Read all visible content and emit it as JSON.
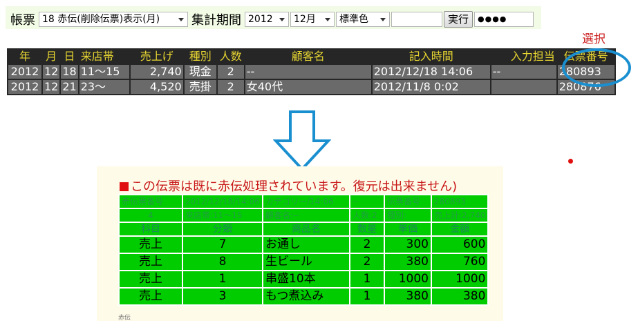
{
  "toolbar": {
    "slip_label": "帳票",
    "slip_select": "18 赤伝(削除伝票)表示(月)",
    "period_label": "集計期間",
    "year_select": "2012",
    "month_select": "12月",
    "color_select": "標準色",
    "text_value": "",
    "run_button": "実行",
    "password_mask": "●●●●"
  },
  "annotation": {
    "select_label": "選択",
    "circle_color": "#1a8fd0",
    "arrow_color": "#1a8fd0"
  },
  "top_table": {
    "headers": [
      "年",
      "月",
      "日",
      "来店帯",
      "売上げ",
      "種別",
      "人数",
      "顧客名",
      "記入時間",
      "入力担当",
      "伝票番号"
    ],
    "rows": [
      [
        "2012",
        "12",
        "18",
        "11～15",
        "2,740",
        "現金",
        "2",
        "--",
        "2012/12/18 14:06",
        "--",
        "280893"
      ],
      [
        "2012",
        "12",
        "21",
        "23～",
        "4,520",
        "売掛",
        "2",
        "女40代",
        "2012/11/8 0:02",
        "",
        "280876"
      ]
    ],
    "header_color": "#e6d531"
  },
  "detail": {
    "message": "この伝票は既に赤伝処理されています。復元は出来ません)",
    "info_row1": [
      "赤伝票番号",
      "2012/12/18/14:06",
      "カテゴリー/14:06",
      "--",
      "伝票番号",
      "280893"
    ],
    "info_row2": [
      "4",
      "来店帯:11～15",
      "顧客名:--",
      "人数:2",
      "種別:",
      "売上計:2,740"
    ],
    "headers": [
      "科目",
      "分類",
      "商品名",
      "数量",
      "単価",
      "金額"
    ],
    "items": [
      [
        "売上",
        "7",
        "お通し",
        "2",
        "300",
        "600"
      ],
      [
        "売上",
        "8",
        "生ビール",
        "2",
        "380",
        "760"
      ],
      [
        "売上",
        "1",
        "串盛10本",
        "1",
        "1000",
        "1000"
      ],
      [
        "売上",
        "3",
        "もつ煮込み",
        "1",
        "380",
        "380"
      ]
    ],
    "footer": "赤伝"
  }
}
